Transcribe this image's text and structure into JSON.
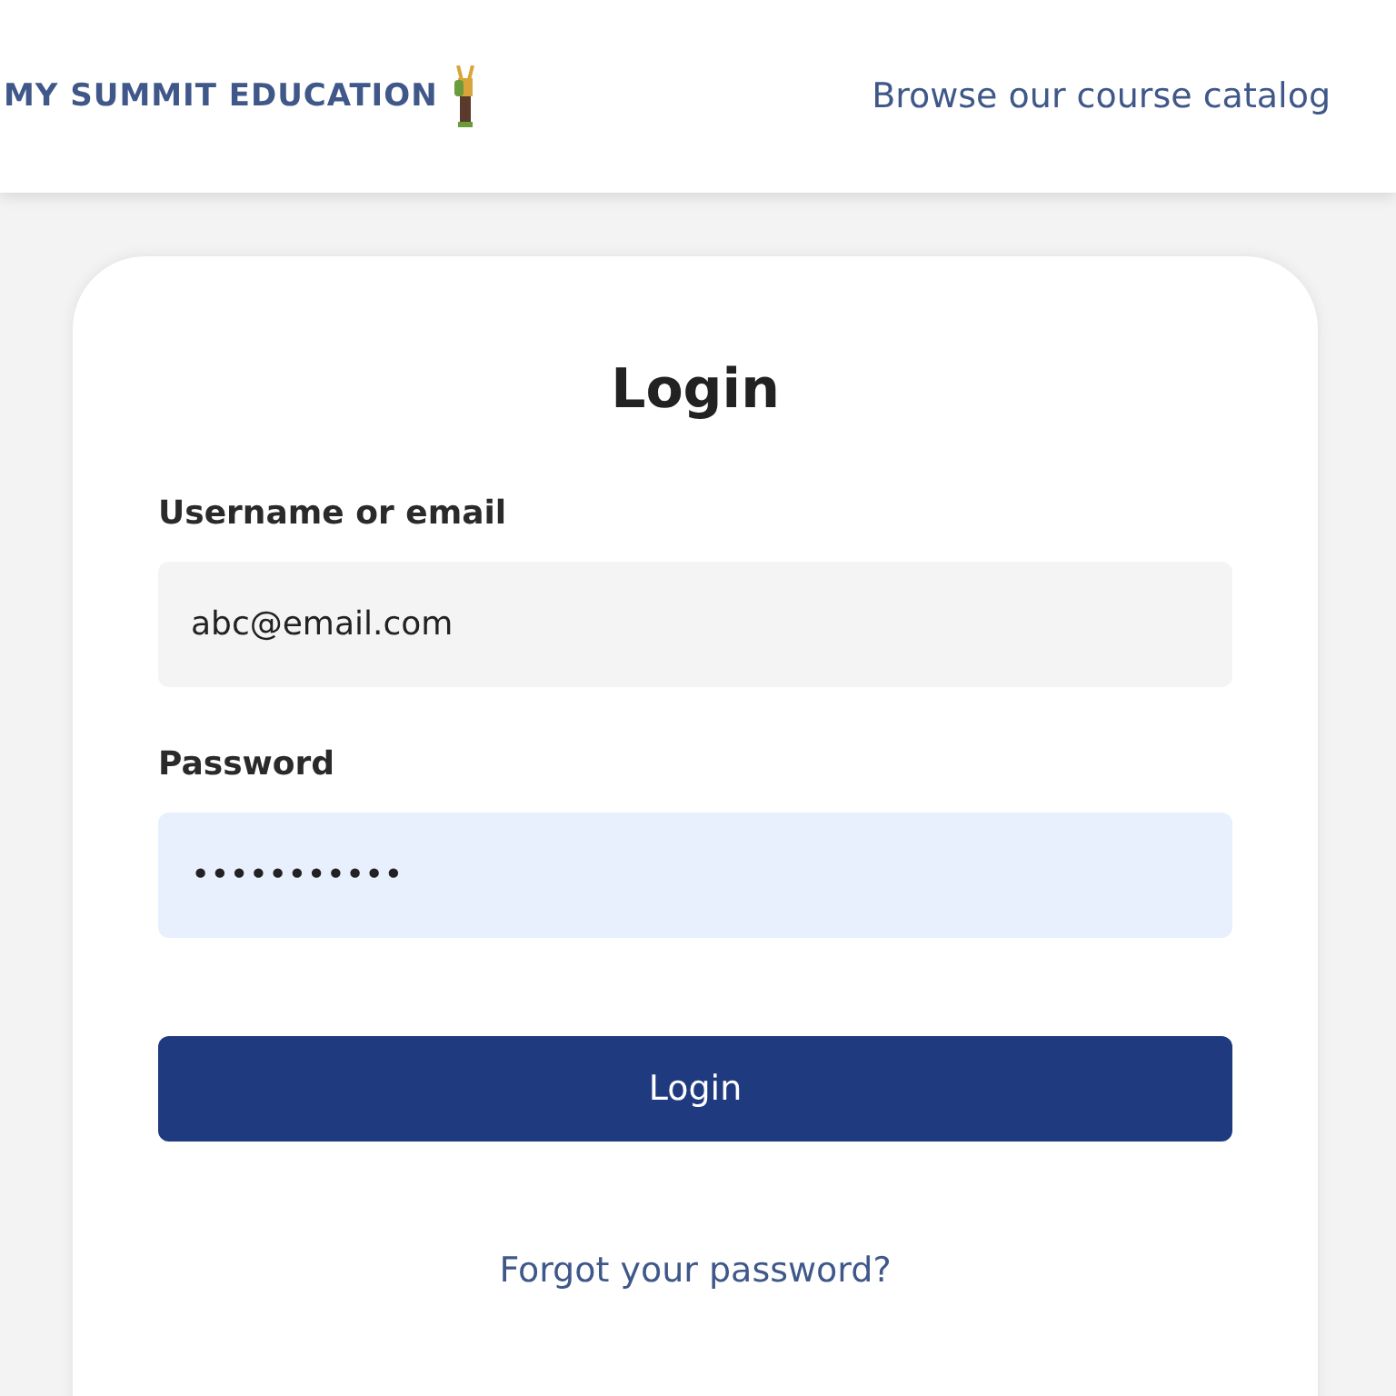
{
  "header": {
    "logo_text": "MY SUMMIT EDUCATION",
    "nav_link": "Browse our course catalog"
  },
  "login": {
    "title": "Login",
    "fields": [
      {
        "label": "Username or email",
        "value": "abc@email.com",
        "focused": false
      },
      {
        "label": "Password",
        "value": "•••••••••••",
        "focused": true
      }
    ],
    "submit": "Login",
    "forgot_link": "Forgot your password?"
  }
}
